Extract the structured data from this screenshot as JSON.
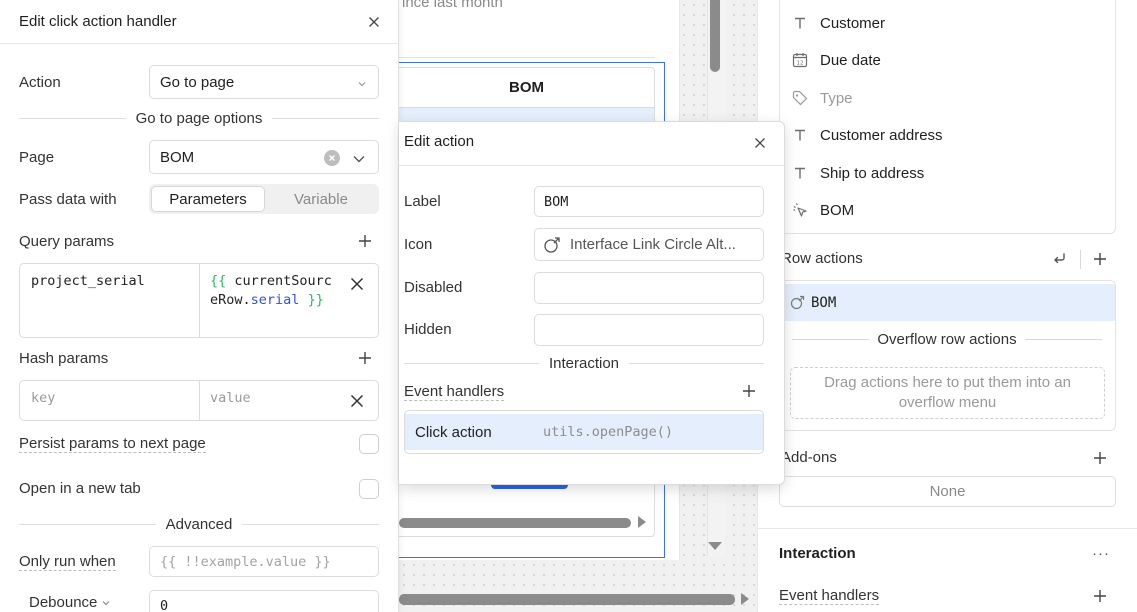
{
  "canvas": {
    "subtitle": "ince last month",
    "table_header": "BOM"
  },
  "left_panel": {
    "title": "Edit click action handler",
    "action": {
      "label": "Action",
      "value": "Go to page"
    },
    "section_page_options": "Go to page options",
    "page": {
      "label": "Page",
      "value": "BOM"
    },
    "pass_data": {
      "label": "Pass data with",
      "options": [
        "Parameters",
        "Variable"
      ],
      "selected": "Parameters"
    },
    "query_params": {
      "label": "Query params",
      "key": "project_serial",
      "value_open": "{{ ",
      "value_id": "currentSourceRow",
      "value_dot": ".",
      "value_prop": "serial",
      "value_close": " }}"
    },
    "hash_params": {
      "label": "Hash params",
      "key_placeholder": "key",
      "value_placeholder": "value"
    },
    "persist_params": "Persist params to next page",
    "open_new_tab": "Open in a new tab",
    "section_advanced": "Advanced",
    "only_run_when": {
      "label": "Only run when",
      "placeholder": "{{ !!example.value }}"
    },
    "debounce": {
      "label": "Debounce",
      "value": "0"
    }
  },
  "popover": {
    "title": "Edit action",
    "label": {
      "label": "Label",
      "value": "BOM"
    },
    "icon": {
      "label": "Icon",
      "value": "Interface Link Circle Alt..."
    },
    "disabled": {
      "label": "Disabled"
    },
    "hidden": {
      "label": "Hidden"
    },
    "section_interaction": "Interaction",
    "event_handlers_label": "Event handlers",
    "event": {
      "name": "Click action",
      "code": "utils.openPage()"
    }
  },
  "inspector": {
    "columns": [
      {
        "label": "Customer",
        "icon": "text-type-icon",
        "dim": false
      },
      {
        "label": "Due date",
        "icon": "calendar-icon",
        "dim": false
      },
      {
        "label": "Type",
        "icon": "tag-icon",
        "dim": true
      },
      {
        "label": "Customer address",
        "icon": "text-type-icon",
        "dim": false
      },
      {
        "label": "Ship to address",
        "icon": "text-type-icon",
        "dim": false
      },
      {
        "label": "BOM",
        "icon": "cursor-click-icon",
        "dim": false
      }
    ],
    "row_actions_label": "Row actions",
    "row_action_item": "BOM",
    "overflow_label": "Overflow row actions",
    "overflow_drop_hint": "Drag actions here to put them into an overflow menu",
    "addons_label": "Add-ons",
    "addons_value": "None",
    "interaction_heading": "Interaction",
    "interaction_more": "···",
    "event_handlers_label": "Event handlers"
  },
  "colors": {
    "accent_blue": "#2a62e8",
    "selection_bg": "#e5eefc",
    "template_brace": "#2fb56a",
    "template_prop": "#3554c8"
  }
}
